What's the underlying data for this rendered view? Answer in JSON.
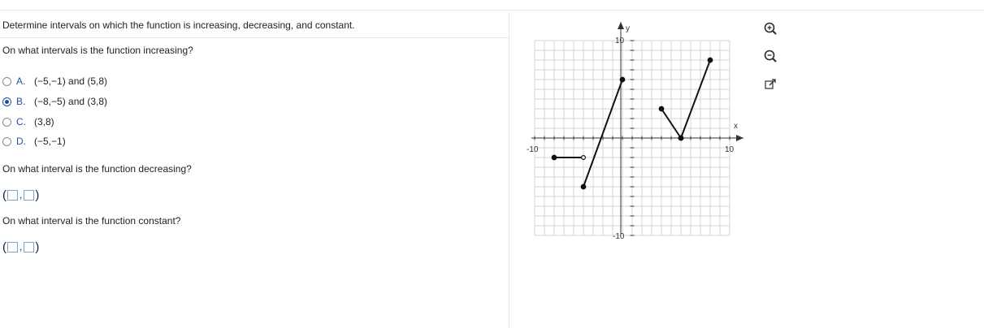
{
  "instructions": "Determine intervals on which the function is increasing, decreasing, and constant.",
  "q1": {
    "prompt": "On what intervals is the function increasing?",
    "options": [
      {
        "letter": "A.",
        "text": "(−5,−1) and (5,8)",
        "selected": false
      },
      {
        "letter": "B.",
        "text": "(−8,−5) and (3,8)",
        "selected": true
      },
      {
        "letter": "C.",
        "text": "(3,8)",
        "selected": false
      },
      {
        "letter": "D.",
        "text": "(−5,−1)",
        "selected": false
      }
    ]
  },
  "q2": {
    "prompt": "On what interval is the function decreasing?",
    "open_paren": "(",
    "comma": ",",
    "close_paren": ")"
  },
  "q3": {
    "prompt": "On what interval is the function constant?",
    "open_paren": "(",
    "comma": ",",
    "close_paren": ")"
  },
  "graph": {
    "y_label": "y",
    "x_label": "x",
    "tick_y_top": "10",
    "tick_y_bottom": "-10",
    "tick_x_left": "-10",
    "tick_x_right": "10",
    "range": {
      "x": [
        -10,
        10
      ],
      "y": [
        -10,
        10
      ]
    },
    "segments": [
      {
        "from": [
          -8,
          -2
        ],
        "to": [
          -5,
          -2
        ],
        "start": "closed",
        "end": "open"
      },
      {
        "from": [
          -5,
          -5
        ],
        "to": [
          -1,
          6
        ],
        "start": "closed",
        "end": "closed"
      },
      {
        "from": [
          3,
          3
        ],
        "to": [
          5,
          0
        ],
        "start": "closed",
        "end": "closed"
      },
      {
        "from": [
          5,
          0
        ],
        "to": [
          8,
          8
        ],
        "start": "closed",
        "end": "closed"
      }
    ]
  },
  "tools": {
    "zoom_in": "zoom-in-icon",
    "zoom_out": "zoom-out-icon",
    "popout": "popout-icon"
  }
}
